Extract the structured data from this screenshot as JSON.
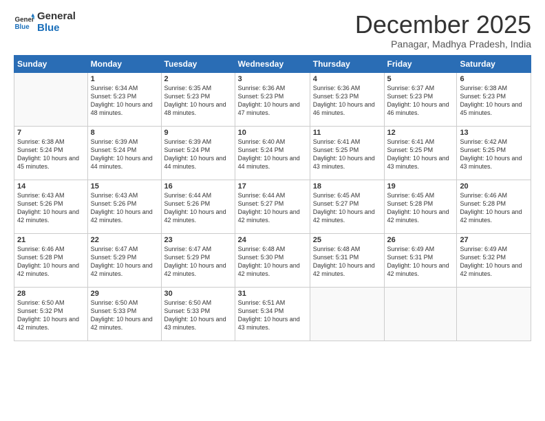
{
  "logo": {
    "general": "General",
    "blue": "Blue"
  },
  "title": "December 2025",
  "subtitle": "Panagar, Madhya Pradesh, India",
  "weekdays": [
    "Sunday",
    "Monday",
    "Tuesday",
    "Wednesday",
    "Thursday",
    "Friday",
    "Saturday"
  ],
  "weeks": [
    [
      {
        "day": "",
        "sunrise": "",
        "sunset": "",
        "daylight": ""
      },
      {
        "day": "1",
        "sunrise": "Sunrise: 6:34 AM",
        "sunset": "Sunset: 5:23 PM",
        "daylight": "Daylight: 10 hours and 48 minutes."
      },
      {
        "day": "2",
        "sunrise": "Sunrise: 6:35 AM",
        "sunset": "Sunset: 5:23 PM",
        "daylight": "Daylight: 10 hours and 48 minutes."
      },
      {
        "day": "3",
        "sunrise": "Sunrise: 6:36 AM",
        "sunset": "Sunset: 5:23 PM",
        "daylight": "Daylight: 10 hours and 47 minutes."
      },
      {
        "day": "4",
        "sunrise": "Sunrise: 6:36 AM",
        "sunset": "Sunset: 5:23 PM",
        "daylight": "Daylight: 10 hours and 46 minutes."
      },
      {
        "day": "5",
        "sunrise": "Sunrise: 6:37 AM",
        "sunset": "Sunset: 5:23 PM",
        "daylight": "Daylight: 10 hours and 46 minutes."
      },
      {
        "day": "6",
        "sunrise": "Sunrise: 6:38 AM",
        "sunset": "Sunset: 5:23 PM",
        "daylight": "Daylight: 10 hours and 45 minutes."
      }
    ],
    [
      {
        "day": "7",
        "sunrise": "Sunrise: 6:38 AM",
        "sunset": "Sunset: 5:24 PM",
        "daylight": "Daylight: 10 hours and 45 minutes."
      },
      {
        "day": "8",
        "sunrise": "Sunrise: 6:39 AM",
        "sunset": "Sunset: 5:24 PM",
        "daylight": "Daylight: 10 hours and 44 minutes."
      },
      {
        "day": "9",
        "sunrise": "Sunrise: 6:39 AM",
        "sunset": "Sunset: 5:24 PM",
        "daylight": "Daylight: 10 hours and 44 minutes."
      },
      {
        "day": "10",
        "sunrise": "Sunrise: 6:40 AM",
        "sunset": "Sunset: 5:24 PM",
        "daylight": "Daylight: 10 hours and 44 minutes."
      },
      {
        "day": "11",
        "sunrise": "Sunrise: 6:41 AM",
        "sunset": "Sunset: 5:25 PM",
        "daylight": "Daylight: 10 hours and 43 minutes."
      },
      {
        "day": "12",
        "sunrise": "Sunrise: 6:41 AM",
        "sunset": "Sunset: 5:25 PM",
        "daylight": "Daylight: 10 hours and 43 minutes."
      },
      {
        "day": "13",
        "sunrise": "Sunrise: 6:42 AM",
        "sunset": "Sunset: 5:25 PM",
        "daylight": "Daylight: 10 hours and 43 minutes."
      }
    ],
    [
      {
        "day": "14",
        "sunrise": "Sunrise: 6:43 AM",
        "sunset": "Sunset: 5:26 PM",
        "daylight": "Daylight: 10 hours and 42 minutes."
      },
      {
        "day": "15",
        "sunrise": "Sunrise: 6:43 AM",
        "sunset": "Sunset: 5:26 PM",
        "daylight": "Daylight: 10 hours and 42 minutes."
      },
      {
        "day": "16",
        "sunrise": "Sunrise: 6:44 AM",
        "sunset": "Sunset: 5:26 PM",
        "daylight": "Daylight: 10 hours and 42 minutes."
      },
      {
        "day": "17",
        "sunrise": "Sunrise: 6:44 AM",
        "sunset": "Sunset: 5:27 PM",
        "daylight": "Daylight: 10 hours and 42 minutes."
      },
      {
        "day": "18",
        "sunrise": "Sunrise: 6:45 AM",
        "sunset": "Sunset: 5:27 PM",
        "daylight": "Daylight: 10 hours and 42 minutes."
      },
      {
        "day": "19",
        "sunrise": "Sunrise: 6:45 AM",
        "sunset": "Sunset: 5:28 PM",
        "daylight": "Daylight: 10 hours and 42 minutes."
      },
      {
        "day": "20",
        "sunrise": "Sunrise: 6:46 AM",
        "sunset": "Sunset: 5:28 PM",
        "daylight": "Daylight: 10 hours and 42 minutes."
      }
    ],
    [
      {
        "day": "21",
        "sunrise": "Sunrise: 6:46 AM",
        "sunset": "Sunset: 5:28 PM",
        "daylight": "Daylight: 10 hours and 42 minutes."
      },
      {
        "day": "22",
        "sunrise": "Sunrise: 6:47 AM",
        "sunset": "Sunset: 5:29 PM",
        "daylight": "Daylight: 10 hours and 42 minutes."
      },
      {
        "day": "23",
        "sunrise": "Sunrise: 6:47 AM",
        "sunset": "Sunset: 5:29 PM",
        "daylight": "Daylight: 10 hours and 42 minutes."
      },
      {
        "day": "24",
        "sunrise": "Sunrise: 6:48 AM",
        "sunset": "Sunset: 5:30 PM",
        "daylight": "Daylight: 10 hours and 42 minutes."
      },
      {
        "day": "25",
        "sunrise": "Sunrise: 6:48 AM",
        "sunset": "Sunset: 5:31 PM",
        "daylight": "Daylight: 10 hours and 42 minutes."
      },
      {
        "day": "26",
        "sunrise": "Sunrise: 6:49 AM",
        "sunset": "Sunset: 5:31 PM",
        "daylight": "Daylight: 10 hours and 42 minutes."
      },
      {
        "day": "27",
        "sunrise": "Sunrise: 6:49 AM",
        "sunset": "Sunset: 5:32 PM",
        "daylight": "Daylight: 10 hours and 42 minutes."
      }
    ],
    [
      {
        "day": "28",
        "sunrise": "Sunrise: 6:50 AM",
        "sunset": "Sunset: 5:32 PM",
        "daylight": "Daylight: 10 hours and 42 minutes."
      },
      {
        "day": "29",
        "sunrise": "Sunrise: 6:50 AM",
        "sunset": "Sunset: 5:33 PM",
        "daylight": "Daylight: 10 hours and 42 minutes."
      },
      {
        "day": "30",
        "sunrise": "Sunrise: 6:50 AM",
        "sunset": "Sunset: 5:33 PM",
        "daylight": "Daylight: 10 hours and 43 minutes."
      },
      {
        "day": "31",
        "sunrise": "Sunrise: 6:51 AM",
        "sunset": "Sunset: 5:34 PM",
        "daylight": "Daylight: 10 hours and 43 minutes."
      },
      {
        "day": "",
        "sunrise": "",
        "sunset": "",
        "daylight": ""
      },
      {
        "day": "",
        "sunrise": "",
        "sunset": "",
        "daylight": ""
      },
      {
        "day": "",
        "sunrise": "",
        "sunset": "",
        "daylight": ""
      }
    ]
  ]
}
